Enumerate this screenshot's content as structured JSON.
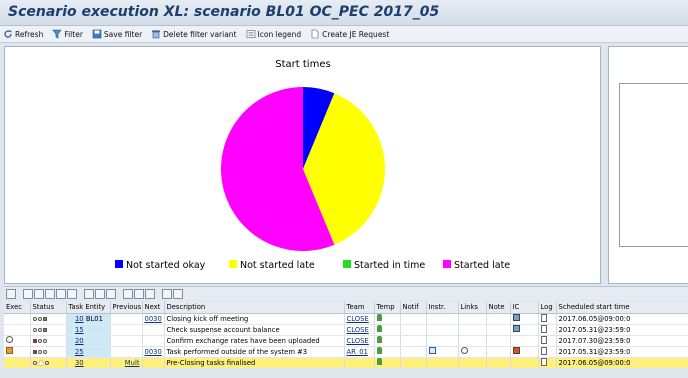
{
  "window": {
    "title": "Scenario execution XL: scenario BL01 OC_PEC 2017_05"
  },
  "toolbar": {
    "refresh": "Refresh",
    "filter": "Filter",
    "save_filter": "Save filter",
    "delete_filter_variant": "Delete filter variant",
    "icon_legend": "Icon legend",
    "create_je_request": "Create JE Request"
  },
  "colors": {
    "not_started_okay": "#0000ff",
    "not_started_late": "#ffff00",
    "started_in_time": "#22dd22",
    "started_late": "#ff00ff"
  },
  "chart_data": {
    "type": "pie",
    "title": "Start times",
    "legend_position": "bottom",
    "slices": [
      {
        "name": "Not started  okay",
        "value": 1,
        "color": "#0000ff"
      },
      {
        "name": "Not started late",
        "value": 6,
        "color": "#ffff00"
      },
      {
        "name": "Started in time",
        "value": 0,
        "color": "#22dd22"
      },
      {
        "name": "Started late",
        "value": 9,
        "color": "#ff00ff"
      }
    ]
  },
  "table": {
    "columns": [
      "Exec",
      "Status",
      "Task Entity",
      "Previous",
      "Next",
      "Description",
      "Team",
      "Temp",
      "Notif",
      "Instr.",
      "Links",
      "Note",
      "IC",
      "Log",
      "Scheduled start time"
    ],
    "rows": [
      {
        "task": "10",
        "entity": "BL01",
        "previous": "",
        "next": "0030",
        "description": "Closing kick off meeting",
        "team": "CLOSE",
        "scheduled": "2017.06.05@09:00:0",
        "exec_icon": "",
        "status": "okg"
      },
      {
        "task": "15",
        "entity": "",
        "previous": "",
        "next": "",
        "description": "Check suspense account balance",
        "team": "CLOSE",
        "scheduled": "2017.05.31@23:59:0",
        "exec_icon": "",
        "status": "okg"
      },
      {
        "task": "20",
        "entity": "",
        "previous": "",
        "next": "",
        "description": "Confirm exchange rates have been uploaded",
        "team": "CLOSE",
        "scheduled": "2017.07.30@23:59:0",
        "exec_icon": "clock",
        "status": "rok"
      },
      {
        "task": "25",
        "entity": "",
        "previous": "",
        "next": "0030",
        "description": "Task performed outside of the system #3",
        "team": "AR_01",
        "scheduled": "2017.05.31@23:59:0",
        "exec_icon": "grid",
        "status": "rok"
      },
      {
        "task": "30",
        "entity": "",
        "previous": "Mult",
        "next": "",
        "description": "Pre-Closing tasks finalised",
        "team": "",
        "scheduled": "2017.06.05@09:00:0",
        "exec_icon": "",
        "status": "tri"
      }
    ]
  }
}
